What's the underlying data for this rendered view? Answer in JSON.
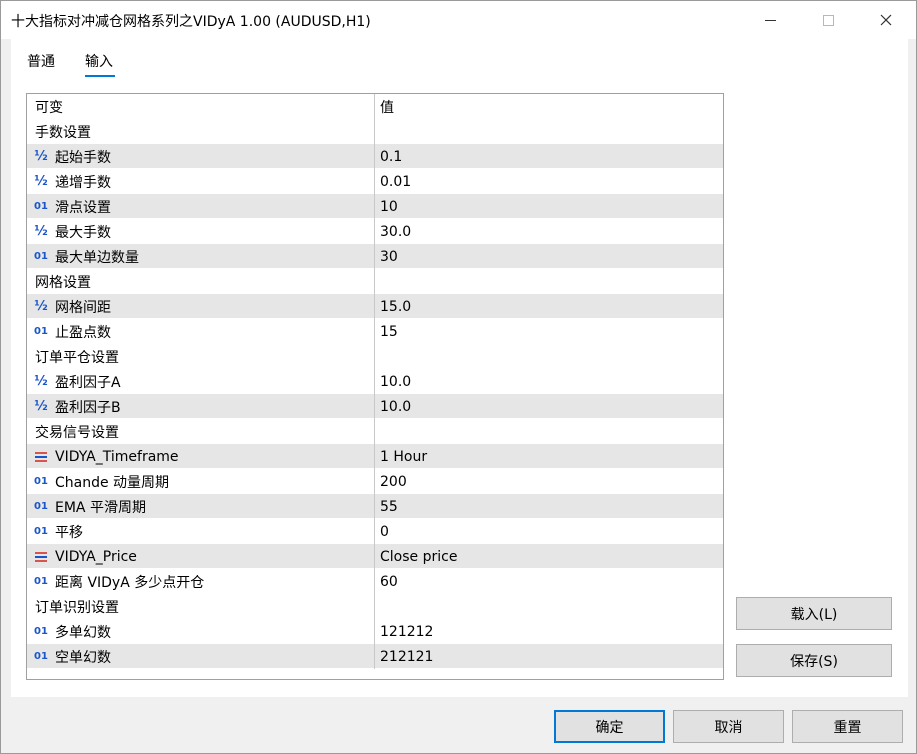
{
  "window": {
    "title": "十大指标对冲减仓网格系列之VIDyA 1.00 (AUDUSD,H1)",
    "minimize_label": "—",
    "close_label": "✕"
  },
  "tabs": [
    {
      "label": "普通",
      "active": false
    },
    {
      "label": "输入",
      "active": true
    }
  ],
  "table": {
    "headers": {
      "name": "可变",
      "value": "值"
    },
    "rows": [
      {
        "kind": "group",
        "name": "手数设置",
        "value": ""
      },
      {
        "kind": "param",
        "type": "double",
        "icon": "fraction-icon",
        "name": "起始手数",
        "value": "0.1"
      },
      {
        "kind": "param",
        "type": "double",
        "icon": "fraction-icon",
        "name": "递增手数",
        "value": "0.01"
      },
      {
        "kind": "param",
        "type": "int",
        "icon": "integer-icon",
        "name": "滑点设置",
        "value": "10"
      },
      {
        "kind": "param",
        "type": "double",
        "icon": "fraction-icon",
        "name": "最大手数",
        "value": "30.0"
      },
      {
        "kind": "param",
        "type": "int",
        "icon": "integer-icon",
        "name": "最大单边数量",
        "value": "30"
      },
      {
        "kind": "group",
        "name": "网格设置",
        "value": ""
      },
      {
        "kind": "param",
        "type": "double",
        "icon": "fraction-icon",
        "name": "网格间距",
        "value": "15.0"
      },
      {
        "kind": "param",
        "type": "int",
        "icon": "integer-icon",
        "name": "止盈点数",
        "value": "15"
      },
      {
        "kind": "group",
        "name": "订单平仓设置",
        "value": ""
      },
      {
        "kind": "param",
        "type": "double",
        "icon": "fraction-icon",
        "name": "盈利因子A",
        "value": "10.0"
      },
      {
        "kind": "param",
        "type": "double",
        "icon": "fraction-icon",
        "name": "盈利因子B",
        "value": "10.0"
      },
      {
        "kind": "group",
        "name": "交易信号设置",
        "value": ""
      },
      {
        "kind": "param",
        "type": "enum",
        "icon": "enum-list-icon",
        "name": "VIDYA_Timeframe",
        "value": "1 Hour"
      },
      {
        "kind": "param",
        "type": "int",
        "icon": "integer-icon",
        "name": "Chande 动量周期",
        "value": "200"
      },
      {
        "kind": "param",
        "type": "int",
        "icon": "integer-icon",
        "name": "EMA 平滑周期",
        "value": "55"
      },
      {
        "kind": "param",
        "type": "int",
        "icon": "integer-icon",
        "name": "平移",
        "value": "0"
      },
      {
        "kind": "param",
        "type": "enum",
        "icon": "enum-list-icon",
        "name": "VIDYA_Price",
        "value": "Close price"
      },
      {
        "kind": "param",
        "type": "int",
        "icon": "integer-icon",
        "name": "距离 VIDyA 多少点开仓",
        "value": "60"
      },
      {
        "kind": "group",
        "name": "订单识别设置",
        "value": ""
      },
      {
        "kind": "param",
        "type": "int",
        "icon": "integer-icon",
        "name": "多单幻数",
        "value": "121212"
      },
      {
        "kind": "param",
        "type": "int",
        "icon": "integer-icon",
        "name": "空单幻数",
        "value": "212121"
      }
    ]
  },
  "type_icons": {
    "int": "01",
    "double": "½"
  },
  "side_buttons": {
    "load_label": "载入(L)",
    "save_label": "保存(S)"
  },
  "footer_buttons": {
    "ok_label": "确定",
    "cancel_label": "取消",
    "reset_label": "重置"
  },
  "colors": {
    "accent": "#0078d7",
    "icon_blue": "#1a56c8",
    "enum_icon_red": "#d9534f",
    "enum_icon_blue": "#1a56c8",
    "alt_row": "#e6e6e6"
  }
}
